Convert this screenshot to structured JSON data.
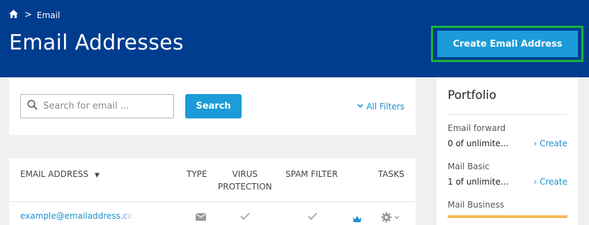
{
  "breadcrumb": {
    "home_icon": "home-icon",
    "separator": ">",
    "current": "Email"
  },
  "page_title": "Email Addresses",
  "cta": {
    "label": "Create Email Address"
  },
  "search": {
    "placeholder": "Search for email ...",
    "value": "",
    "button_label": "Search",
    "filters_label": "All Filters"
  },
  "table": {
    "columns": {
      "email": "EMAIL ADDRESS",
      "type": "TYPE",
      "virus_line1": "VIRUS",
      "virus_line2": "PROTECTION",
      "spam": "SPAM FILTER",
      "tasks": "TASKS"
    },
    "rows": [
      {
        "email": "example@emailaddress.com",
        "type_icon": "envelope-icon",
        "virus": "check-icon",
        "spam": "check-icon",
        "plan_icon": "crown-icon",
        "tasks_icon": "gear-icon"
      }
    ]
  },
  "portfolio": {
    "title": "Portfolio",
    "items": [
      {
        "name": "Email forward",
        "usage": "0 of unlimite...",
        "action": "Create"
      },
      {
        "name": "Mail Basic",
        "usage": "1 of unlimite...",
        "action": "Create"
      },
      {
        "name": "Mail Business"
      }
    ]
  },
  "colors": {
    "header": "#003d8f",
    "accent": "#1b9bd7",
    "highlight": "#18b33b",
    "usage_bar": "#f5b85c"
  }
}
